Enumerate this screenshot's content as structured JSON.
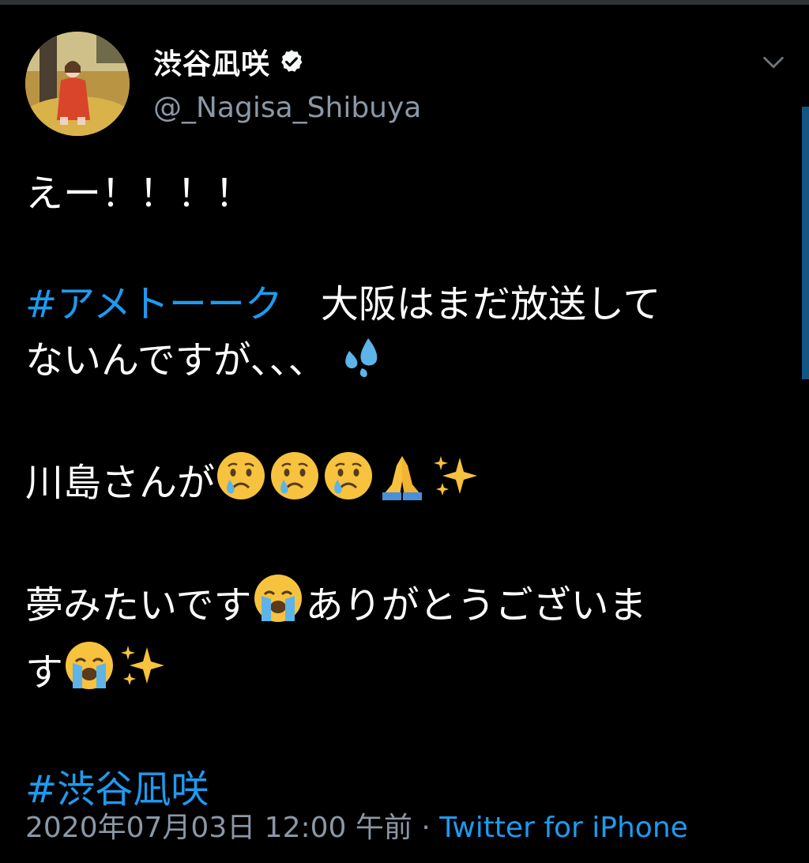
{
  "user": {
    "display_name": "渋谷凪咲",
    "handle": "@_Nagisa_Shibuya",
    "verified": true
  },
  "tweet": {
    "line1": "えー！！！！",
    "hashtag1": "#アメトーーク",
    "line2a": "　大阪はまだ放送して",
    "line2b": "ないんですが、、、",
    "line3": "川島さんが",
    "line4a": "夢みたいです",
    "line4b": "ありがとうございま",
    "line4c": "す",
    "hashtag2": "#渋谷凪咲"
  },
  "meta": {
    "timestamp": "2020年07月03日 12:00 午前",
    "separator": " · ",
    "source": "Twitter for iPhone"
  },
  "icons": {
    "verified": "verified-badge-icon",
    "more": "chevron-down-icon",
    "emojis": [
      "sweat-drops-emoji",
      "crying-face-emoji",
      "folded-hands-emoji",
      "sparkles-emoji",
      "loudly-crying-face-emoji"
    ]
  },
  "colors": {
    "background": "#000000",
    "text": "#ffffff",
    "secondary_text": "#8b98a5",
    "link": "#1d9bf0"
  }
}
